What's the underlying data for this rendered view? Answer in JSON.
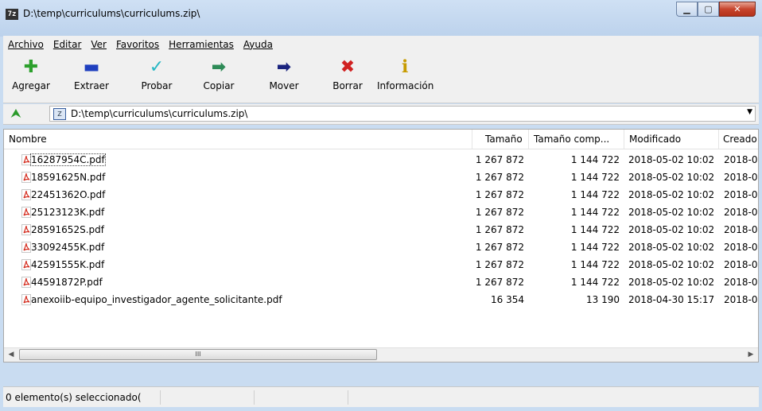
{
  "window": {
    "app_icon": "7z",
    "title": "D:\\temp\\curriculums\\curriculums.zip\\",
    "buttons": [
      "minimize-icon",
      "maximize-icon",
      "close-icon"
    ]
  },
  "menu": [
    "Archivo",
    "Editar",
    "Ver",
    "Favoritos",
    "Herramientas",
    "Ayuda"
  ],
  "toolbar": [
    {
      "label": "Agregar",
      "icon": "plus-icon",
      "glyph": "✚",
      "color": "#2ca02c"
    },
    {
      "label": "Extraer",
      "icon": "minus-icon",
      "glyph": "▬",
      "color": "#1f3fbf"
    },
    {
      "label": "Probar",
      "icon": "check-icon",
      "glyph": "✓",
      "color": "#27b7c4"
    },
    {
      "label": "Copiar",
      "icon": "copy-arrow-icon",
      "glyph": "➡",
      "color": "#2e8b57"
    },
    {
      "label": "Mover",
      "icon": "move-arrow-icon",
      "glyph": "➡",
      "color": "#1a237e"
    },
    {
      "label": "Borrar",
      "icon": "delete-icon",
      "glyph": "✖",
      "color": "#d02020"
    },
    {
      "label": "Información",
      "icon": "info-icon",
      "glyph": "ℹ",
      "color": "#c79b00"
    }
  ],
  "address": {
    "path": "D:\\temp\\curriculums\\curriculums.zip\\"
  },
  "columns": [
    "Nombre",
    "Tamaño",
    "Tamaño comp...",
    "Modificado",
    "Creado"
  ],
  "files": [
    {
      "name": "16287954C.pdf",
      "size": "1 267 872",
      "packed": "1 144 722",
      "modified": "2018-05-02 10:02",
      "created": "2018-0."
    },
    {
      "name": "18591625N.pdf",
      "size": "1 267 872",
      "packed": "1 144 722",
      "modified": "2018-05-02 10:02",
      "created": "2018-0."
    },
    {
      "name": "22451362O.pdf",
      "size": "1 267 872",
      "packed": "1 144 722",
      "modified": "2018-05-02 10:02",
      "created": "2018-0."
    },
    {
      "name": "25123123K.pdf",
      "size": "1 267 872",
      "packed": "1 144 722",
      "modified": "2018-05-02 10:02",
      "created": "2018-0."
    },
    {
      "name": "28591652S.pdf",
      "size": "1 267 872",
      "packed": "1 144 722",
      "modified": "2018-05-02 10:02",
      "created": "2018-0."
    },
    {
      "name": "33092455K.pdf",
      "size": "1 267 872",
      "packed": "1 144 722",
      "modified": "2018-05-02 10:02",
      "created": "2018-0."
    },
    {
      "name": "42591555K.pdf",
      "size": "1 267 872",
      "packed": "1 144 722",
      "modified": "2018-05-02 10:02",
      "created": "2018-0."
    },
    {
      "name": "44591872P.pdf",
      "size": "1 267 872",
      "packed": "1 144 722",
      "modified": "2018-05-02 10:02",
      "created": "2018-0."
    },
    {
      "name": "anexoiib-equipo_investigador_agente_solicitante.pdf",
      "size": "16 354",
      "packed": "13 190",
      "modified": "2018-04-30 15:17",
      "created": "2018-0."
    }
  ],
  "scrollbar": {
    "thumb_glyph": "III"
  },
  "status": {
    "selection": "0 elemento(s) seleccionado("
  }
}
